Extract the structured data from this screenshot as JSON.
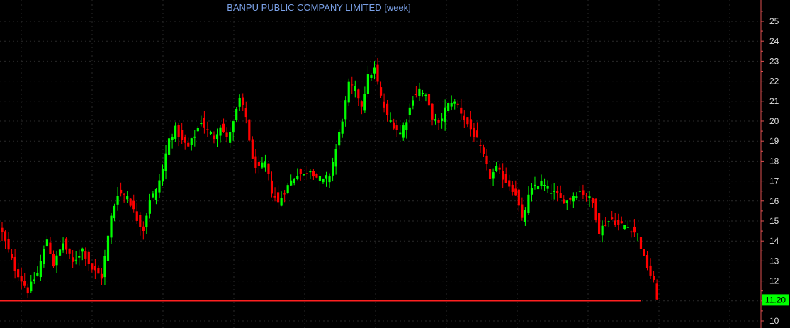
{
  "chart_data": {
    "type": "candlestick",
    "title": "BANPU PUBLIC COMPANY LIMITED [week]",
    "xlabel": "",
    "ylabel": "",
    "ylim": [
      10,
      25.9
    ],
    "y_ticks": [
      10,
      11,
      12,
      13,
      14,
      15,
      16,
      17,
      18,
      19,
      20,
      21,
      22,
      23,
      24,
      25
    ],
    "grid": true,
    "axis_side": "right",
    "colors": {
      "up": "#00ff00",
      "down": "#ff0000",
      "background": "#000000",
      "grid": "#2a2a2a",
      "axis": "#e05050",
      "horizontal_line": "#ff2020",
      "title": "#7aa0e6",
      "price_label_bg": "#00ff00",
      "price_label_text": "#000000"
    },
    "horizontal_line": 11,
    "current_price_label": "11.20",
    "waypoints": [
      [
        0,
        14.4
      ],
      [
        4,
        12.6
      ],
      [
        8,
        11.5
      ],
      [
        11,
        12.4
      ],
      [
        14,
        14.1
      ],
      [
        16,
        12.8
      ],
      [
        19,
        13.9
      ],
      [
        22,
        12.9
      ],
      [
        25,
        13.6
      ],
      [
        28,
        12.6
      ],
      [
        31,
        12.2
      ],
      [
        34,
        15.2
      ],
      [
        36,
        16.4
      ],
      [
        39,
        16.3
      ],
      [
        42,
        15.1
      ],
      [
        44,
        14.6
      ],
      [
        46,
        16.1
      ],
      [
        48,
        16.5
      ],
      [
        50,
        17.6
      ],
      [
        52,
        19.1
      ],
      [
        54,
        19.6
      ],
      [
        56,
        19.0
      ],
      [
        58,
        18.7
      ],
      [
        60,
        19.3
      ],
      [
        62,
        20.0
      ],
      [
        64,
        19.5
      ],
      [
        66,
        19.2
      ],
      [
        68,
        19.8
      ],
      [
        70,
        19.1
      ],
      [
        72,
        19.9
      ],
      [
        74,
        21.1
      ],
      [
        76,
        20.2
      ],
      [
        78,
        18.0
      ],
      [
        80,
        17.6
      ],
      [
        82,
        17.9
      ],
      [
        84,
        16.5
      ],
      [
        86,
        15.9
      ],
      [
        88,
        16.5
      ],
      [
        90,
        17.0
      ],
      [
        92,
        17.4
      ],
      [
        94,
        17.3
      ],
      [
        96,
        17.6
      ],
      [
        98,
        17.2
      ],
      [
        100,
        17.0
      ],
      [
        102,
        17.3
      ],
      [
        104,
        18.6
      ],
      [
        106,
        20.1
      ],
      [
        108,
        21.8
      ],
      [
        110,
        21.6
      ],
      [
        112,
        20.8
      ],
      [
        114,
        22.2
      ],
      [
        116,
        22.6
      ],
      [
        118,
        21.2
      ],
      [
        120,
        20.2
      ],
      [
        122,
        19.8
      ],
      [
        124,
        19.4
      ],
      [
        126,
        20.1
      ],
      [
        128,
        21.2
      ],
      [
        130,
        21.6
      ],
      [
        132,
        21.2
      ],
      [
        134,
        20.2
      ],
      [
        136,
        19.8
      ],
      [
        138,
        20.6
      ],
      [
        140,
        21.0
      ],
      [
        142,
        20.8
      ],
      [
        144,
        20.1
      ],
      [
        146,
        19.6
      ],
      [
        148,
        19.0
      ],
      [
        150,
        18.2
      ],
      [
        152,
        17.2
      ],
      [
        154,
        17.6
      ],
      [
        156,
        17.2
      ],
      [
        158,
        16.8
      ],
      [
        160,
        16.4
      ],
      [
        162,
        15.0
      ],
      [
        164,
        16.2
      ],
      [
        166,
        16.8
      ],
      [
        168,
        16.9
      ],
      [
        170,
        16.6
      ],
      [
        172,
        16.4
      ],
      [
        174,
        16.1
      ],
      [
        176,
        16.0
      ],
      [
        178,
        16.3
      ],
      [
        180,
        16.5
      ],
      [
        182,
        16.3
      ],
      [
        184,
        15.9
      ],
      [
        186,
        14.5
      ],
      [
        188,
        14.9
      ],
      [
        190,
        15.1
      ],
      [
        192,
        14.8
      ],
      [
        194,
        14.8
      ],
      [
        196,
        14.6
      ],
      [
        198,
        14.3
      ],
      [
        200,
        13.1
      ],
      [
        202,
        12.3
      ],
      [
        203,
        11.9
      ],
      [
        204,
        11.2
      ]
    ]
  }
}
